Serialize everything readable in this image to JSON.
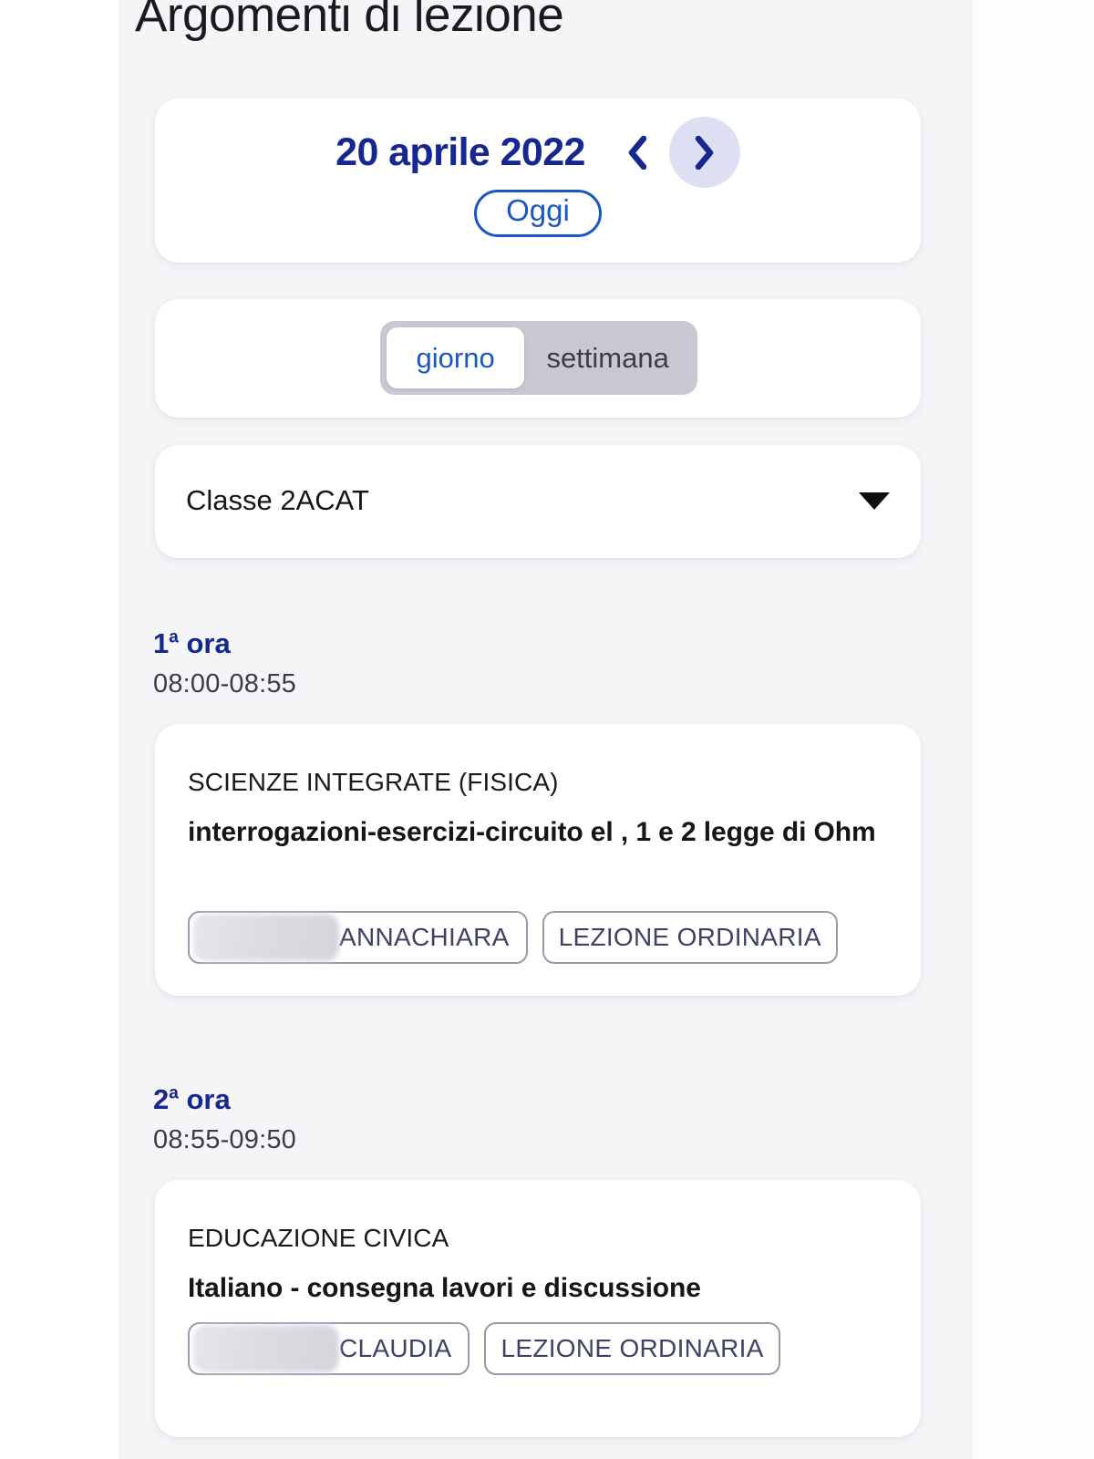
{
  "header": {
    "title": "Argomenti di lezione"
  },
  "date_selector": {
    "date_label": "20 aprile 2022",
    "prev_icon": "chevron-left-icon",
    "next_icon": "chevron-right-icon",
    "today_label": "Oggi"
  },
  "view_toggle": {
    "options": [
      {
        "label": "giorno",
        "active": true
      },
      {
        "label": "settimana",
        "active": false
      }
    ]
  },
  "class_select": {
    "value": "Classe 2ACAT",
    "caret_icon": "chevron-down-icon"
  },
  "colors": {
    "navy": "#16288F",
    "blue_accent": "#1A57C4",
    "page_bg": "#F5F5F8",
    "card_bg": "#FFFFFF",
    "toggle_track": "#C8C8D2",
    "next_circle": "#DFDFF3",
    "tag_text": "#3F4263",
    "tag_border": "#9A9AAD"
  },
  "lessons": [
    {
      "hour_number": "1",
      "hour_ordinal": "a",
      "hour_label": "ora",
      "time_range": "08:00-08:55",
      "subject": "SCIENZE INTEGRATE (FISICA)",
      "topic": "interrogazioni-esercizi-circuito el , 1 e 2 legge di Ohm",
      "teacher_tag": {
        "redacted": true,
        "visible_text": "ANNACHIARA"
      },
      "type_tag": "LEZIONE ORDINARIA"
    },
    {
      "hour_number": "2",
      "hour_ordinal": "a",
      "hour_label": "ora",
      "time_range": "08:55-09:50",
      "subject": "EDUCAZIONE CIVICA",
      "topic": "Italiano - consegna lavori e discussione",
      "teacher_tag": {
        "redacted": true,
        "visible_text": "CLAUDIA"
      },
      "type_tag": "LEZIONE ORDINARIA"
    }
  ]
}
